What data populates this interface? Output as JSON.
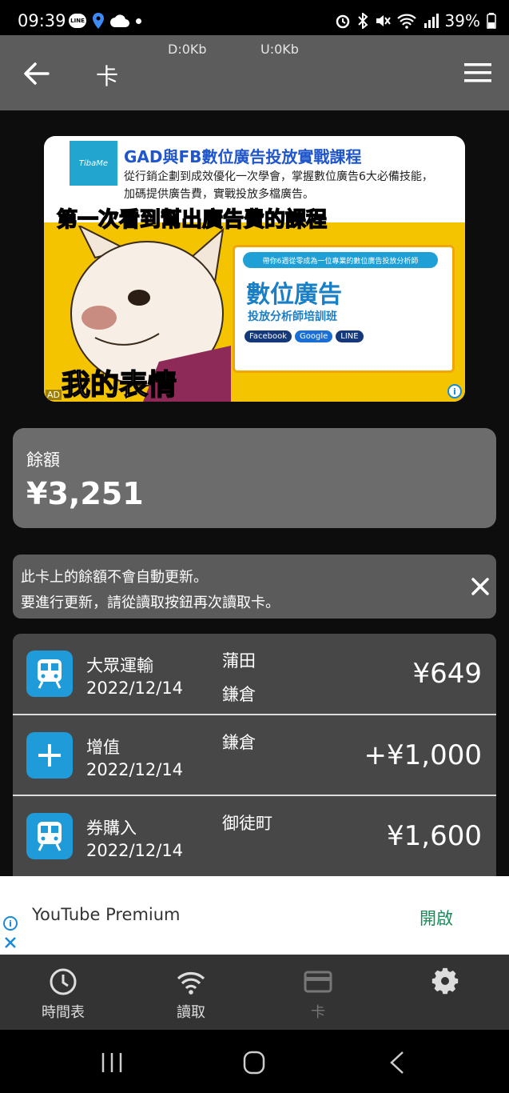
{
  "status_bar": {
    "time": "09:39",
    "line_badge": "LINE",
    "battery_text": "39%"
  },
  "app_bar": {
    "download_speed": "D:0Kb",
    "upload_speed": "U:0Kb",
    "title": "卡"
  },
  "ad_top": {
    "brand_logo": "TibaMe",
    "title": "GAD與FB數位廣告投放實戰課程",
    "description": "從行銷企劃到成效優化一次學會，掌握數位廣告6大必備技能，加碼提供廣告費，實戰投放多檔廣告。",
    "caption_top": "第一次看到幫出廣告費的課程",
    "caption_bottom": "我的表情",
    "panel_sub": "帶你6週從零成為一位專業的數位廣告投放分析師",
    "panel_main": "數位廣告",
    "panel_line": "投放分析師培訓班",
    "panel_tags": [
      "Facebook",
      "Google",
      "LINE"
    ],
    "ad_label": "AD"
  },
  "balance": {
    "label": "餘額",
    "value": "¥3,251"
  },
  "notice": {
    "line1": "此卡上的餘額不會自動更新。",
    "line2": "要進行更新，請從讀取按鈕再次讀取卡。"
  },
  "transactions": [
    {
      "type": "大眾運輸",
      "date": "2022/12/14",
      "station_1": "蒲田",
      "station_2": "鎌倉",
      "amount": "¥649",
      "icon": "train-icon"
    },
    {
      "type": "增值",
      "date": "2022/12/14",
      "station_1": "鎌倉",
      "station_2": "",
      "amount": "+¥1,000",
      "icon": "plus-icon"
    },
    {
      "type": "券購入",
      "date": "2022/12/14",
      "station_1": "御徒町",
      "station_2": "",
      "amount": "¥1,600",
      "icon": "train-icon"
    }
  ],
  "ad_bottom": {
    "title": "YouTube Premium",
    "action": "開啟"
  },
  "bottom_nav": {
    "items": [
      {
        "label": "時間表",
        "icon": "clock-icon",
        "active": true
      },
      {
        "label": "讀取",
        "icon": "wifi-icon",
        "active": true
      },
      {
        "label": "卡",
        "icon": "card-icon",
        "active": false
      },
      {
        "label": "",
        "icon": "gear-icon",
        "active": true
      }
    ]
  },
  "colors": {
    "app_bar": "#5c5c5c",
    "accent_blue": "#1e9bd8",
    "ad_action_green": "#1b8a5a"
  }
}
